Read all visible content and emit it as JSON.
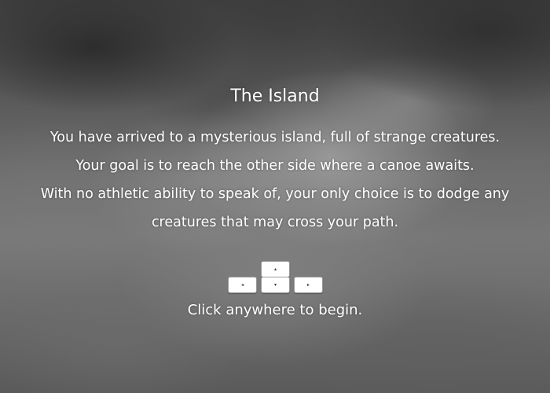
{
  "game": {
    "title": "The Island",
    "intro_lines": [
      "You have arrived to a mysterious island, full of strange creatures.",
      "Your goal is to reach the other side where a canoe awaits.",
      "With no athletic ability to speak of, your only choice is to dodge any",
      "creatures that may cross your path."
    ],
    "controls": {
      "up_glyph": "▴",
      "left_glyph": "◂",
      "down_glyph": "▾",
      "right_glyph": "▸",
      "icons": [
        "arrow-up-key-icon",
        "arrow-left-key-icon",
        "arrow-down-key-icon",
        "arrow-right-key-icon"
      ]
    },
    "start_prompt": "Click anywhere to begin."
  },
  "colors": {
    "text": "#ffffff",
    "background": "#6a6a6a",
    "key_face": "#ffffff"
  }
}
